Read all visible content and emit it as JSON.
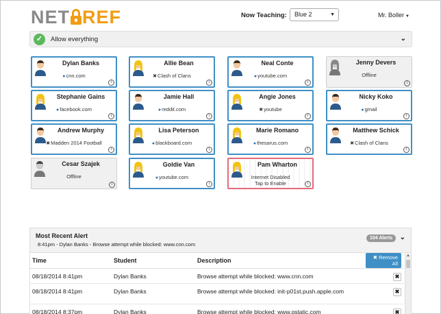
{
  "logo": {
    "left": "NET",
    "right": "REF"
  },
  "header": {
    "now_teaching_label": "Now Teaching:",
    "class_selected": "Blue 2",
    "user_menu": "Mr. Boller"
  },
  "allow_bar": {
    "label": "Allow everything"
  },
  "students": [
    {
      "name": "Dylan Banks",
      "site": "cnn.com",
      "site_icon": "globe-icon",
      "status": "active",
      "avatar": "male"
    },
    {
      "name": "Allie Bean",
      "site": "Clash of Clans",
      "site_icon": "app-icon",
      "status": "active",
      "avatar": "female"
    },
    {
      "name": "Neal Conte",
      "site": "youtube.com",
      "site_icon": "globe-icon",
      "status": "active",
      "avatar": "male"
    },
    {
      "name": "Jenny Devers",
      "site": "Offline",
      "site_icon": "",
      "status": "offline",
      "avatar": "female"
    },
    {
      "name": "Stephanie Gains",
      "site": "facebook.com",
      "site_icon": "globe-icon",
      "status": "active",
      "avatar": "female"
    },
    {
      "name": "Jamie Hall",
      "site": "reddit.com",
      "site_icon": "globe-icon",
      "status": "active",
      "avatar": "male"
    },
    {
      "name": "Angie Jones",
      "site": "youtube",
      "site_icon": "app-icon",
      "status": "active",
      "avatar": "female"
    },
    {
      "name": "Nicky Koko",
      "site": "gmail",
      "site_icon": "globe-icon",
      "status": "active",
      "avatar": "male"
    },
    {
      "name": "Andrew Murphy",
      "site": "Madden 2014 Football",
      "site_icon": "app-icon",
      "status": "active",
      "avatar": "male"
    },
    {
      "name": "Lisa Peterson",
      "site": "blackboard.com",
      "site_icon": "globe-icon",
      "status": "active",
      "avatar": "female"
    },
    {
      "name": "Marie Romano",
      "site": "thesarus.com",
      "site_icon": "globe-icon",
      "status": "active",
      "avatar": "female"
    },
    {
      "name": "Matthew Schick",
      "site": "Clash of Clans",
      "site_icon": "app-icon",
      "status": "active",
      "avatar": "male"
    },
    {
      "name": "Cesar Szajek",
      "site": "Offline",
      "site_icon": "",
      "status": "offline",
      "avatar": "male"
    },
    {
      "name": "Goldie Van",
      "site": "youtube.com",
      "site_icon": "globe-icon",
      "status": "active",
      "avatar": "female"
    },
    {
      "name": "Pam Wharton",
      "site": "Internet Disabled\nTap to Enable",
      "site_icon": "",
      "status": "disabled",
      "avatar": "female"
    }
  ],
  "alerts": {
    "title": "Most Recent Alert",
    "latest": "8:41pm - Dylan Banks - Browse attempt while blocked: www.cnn.com",
    "badge": "104 Alerts",
    "columns": {
      "time": "Time",
      "student": "Student",
      "description": "Description"
    },
    "remove_all": "Remove All",
    "rows": [
      {
        "time": "08/18/2014 8:41pm",
        "student": "Dylan Banks",
        "description": "Browse attempt while blocked: www.cnn.com"
      },
      {
        "time": "08/18/2014 8:41pm",
        "student": "Dylan Banks",
        "description": "Browse attempt while blocked: init-p01st.push.apple.com"
      },
      {
        "time": "08/18/2014 8:37pm",
        "student": "Dylan Banks",
        "description": "Browse attempt while blocked: www.gstatic.com"
      }
    ]
  },
  "colors": {
    "accent": "#3d8fc6",
    "logo_orange": "#f39c12",
    "logo_gray": "#8a8a8a",
    "success": "#5cb85c",
    "disabled_border": "#e36a7a"
  }
}
